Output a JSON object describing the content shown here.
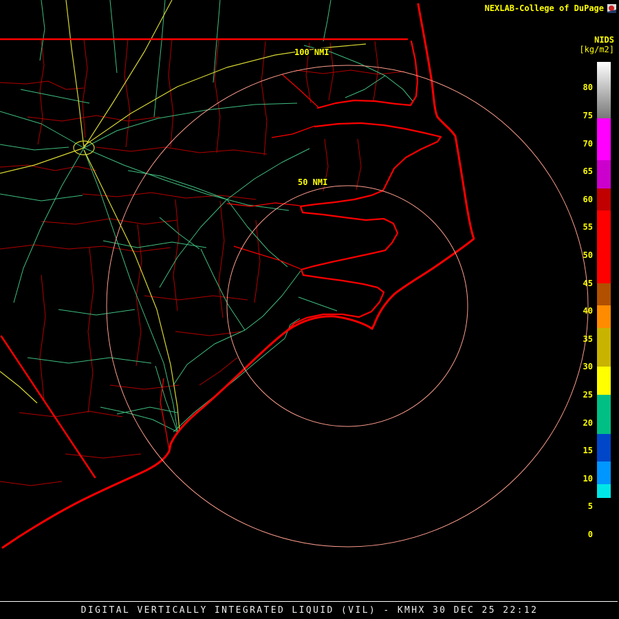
{
  "header": {
    "title": "NEXLAB-College of DuPage"
  },
  "product": {
    "name": "NIDS",
    "units": "[kg/m2]"
  },
  "colorbar": {
    "scale": {
      "min": -1.6,
      "max": 84.6
    },
    "ticks": [
      80,
      75,
      70,
      65,
      60,
      55,
      50,
      45,
      40,
      35,
      30,
      25,
      20,
      15,
      10,
      5,
      0
    ],
    "segments": [
      {
        "from": 74.5,
        "to": 84.6,
        "background": "linear-gradient(#ffffff, #787878)"
      },
      {
        "from": 67,
        "to": 74.5,
        "background": "#ff00ff"
      },
      {
        "from": 62,
        "to": 67,
        "background": "#cc00cc"
      },
      {
        "from": 58,
        "to": 62,
        "background": "#c00000"
      },
      {
        "from": 45,
        "to": 58,
        "background": "#ff0000"
      },
      {
        "from": 41,
        "to": 45,
        "background": "#b05000"
      },
      {
        "from": 37,
        "to": 41,
        "background": "#ff8c00"
      },
      {
        "from": 30,
        "to": 37,
        "background": "#c8b400"
      },
      {
        "from": 25,
        "to": 30,
        "background": "#ffff00"
      },
      {
        "from": 18,
        "to": 25,
        "background": "#00bf84"
      },
      {
        "from": 13,
        "to": 18,
        "background": "#0046c8"
      },
      {
        "from": 9,
        "to": 13,
        "background": "#0096ff"
      },
      {
        "from": 6.5,
        "to": 9,
        "background": "#00e6e6"
      },
      {
        "from": -1.6,
        "to": 6.5,
        "background": "#000000"
      }
    ]
  },
  "rings": [
    {
      "label": "100 NMI"
    },
    {
      "label": "50 NMI"
    }
  ],
  "footer": {
    "caption": "DIGITAL VERTICALLY INTEGRATED LIQUID (VIL) - KMHX 30 DEC 25 22:12"
  },
  "colors": {
    "background": "#000000",
    "coastline": "#ff0000",
    "county_border": "#b40000",
    "road_primary": "#3fbf7f",
    "road_interstate": "#d8d832",
    "range_ring": "#ff9e8e",
    "label_yellow": "#ffff00",
    "footer_text": "#ededed"
  }
}
